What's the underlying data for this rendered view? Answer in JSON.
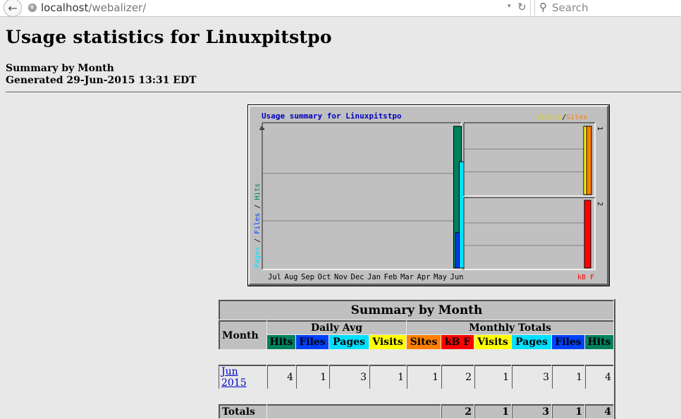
{
  "browser": {
    "url_host": "localhost",
    "url_path": "/webalizer/",
    "search_placeholder": "Search",
    "back_icon": "←",
    "dropdown_icon": "▾",
    "reload_icon": "↻",
    "search_icon": "🔍"
  },
  "page": {
    "title": "Usage statistics for Linuxpitstpo",
    "subtitle": "Summary by Month",
    "generated": "Generated 29-Jun-2015 13:31 EDT"
  },
  "chart_data": {
    "type": "bar",
    "title": "Usage summary for Linuxpitstpo",
    "categories": [
      "Jul",
      "Aug",
      "Sep",
      "Oct",
      "Nov",
      "Dec",
      "Jan",
      "Feb",
      "Mar",
      "Apr",
      "May",
      "Jun"
    ],
    "panels": [
      {
        "name": "main",
        "ylabel_parts": [
          {
            "text": "Pages",
            "color": "#00e0ff"
          },
          {
            "text": " / ",
            "color": "#000000"
          },
          {
            "text": "Files",
            "color": "#0040ff"
          },
          {
            "text": " / ",
            "color": "#000000"
          },
          {
            "text": "Hits",
            "color": "#00805c"
          }
        ],
        "ymax": 4,
        "ymax_label": "4",
        "series": [
          {
            "name": "Hits",
            "color": "#00805c",
            "values": [
              0,
              0,
              0,
              0,
              0,
              0,
              0,
              0,
              0,
              0,
              0,
              4
            ]
          },
          {
            "name": "Files",
            "color": "#0040ff",
            "values": [
              0,
              0,
              0,
              0,
              0,
              0,
              0,
              0,
              0,
              0,
              0,
              1
            ]
          },
          {
            "name": "Pages",
            "color": "#00e0ff",
            "values": [
              0,
              0,
              0,
              0,
              0,
              0,
              0,
              0,
              0,
              0,
              0,
              3
            ]
          }
        ]
      },
      {
        "name": "visits-sites",
        "legend_parts": [
          {
            "text": "Visits",
            "color": "#ffff00"
          },
          {
            "text": "/",
            "color": "#000000"
          },
          {
            "text": "Sites",
            "color": "#ff8000"
          }
        ],
        "ymax": 1,
        "ymax_label": "1",
        "series": [
          {
            "name": "Visits",
            "color": "#ffff00",
            "values": [
              0,
              0,
              0,
              0,
              0,
              0,
              0,
              0,
              0,
              0,
              0,
              1
            ]
          },
          {
            "name": "Sites",
            "color": "#ff8000",
            "values": [
              0,
              0,
              0,
              0,
              0,
              0,
              0,
              0,
              0,
              0,
              0,
              1
            ]
          }
        ]
      },
      {
        "name": "kbytes",
        "legend_parts": [
          {
            "text": "kB F",
            "color": "#ff0000"
          }
        ],
        "ymax": 2,
        "ymax_label": "2",
        "series": [
          {
            "name": "kB F",
            "color": "#ff0000",
            "values": [
              0,
              0,
              0,
              0,
              0,
              0,
              0,
              0,
              0,
              0,
              0,
              2
            ]
          }
        ]
      }
    ],
    "grid": true
  },
  "table": {
    "title": "Summary by Month",
    "month_header": "Month",
    "daily_avg_header": "Daily Avg",
    "monthly_totals_header": "Monthly Totals",
    "daily_cols": [
      "Hits",
      "Files",
      "Pages",
      "Visits"
    ],
    "monthly_cols": [
      "Sites",
      "kB F",
      "Visits",
      "Pages",
      "Files",
      "Hits"
    ],
    "rows": [
      {
        "month": "Jun 2015",
        "daily": [
          "4",
          "1",
          "3",
          "1"
        ],
        "monthly": [
          "1",
          "2",
          "1",
          "3",
          "1",
          "4"
        ]
      }
    ],
    "totals_label": "Totals",
    "totals": [
      "2",
      "1",
      "3",
      "1",
      "4"
    ]
  }
}
